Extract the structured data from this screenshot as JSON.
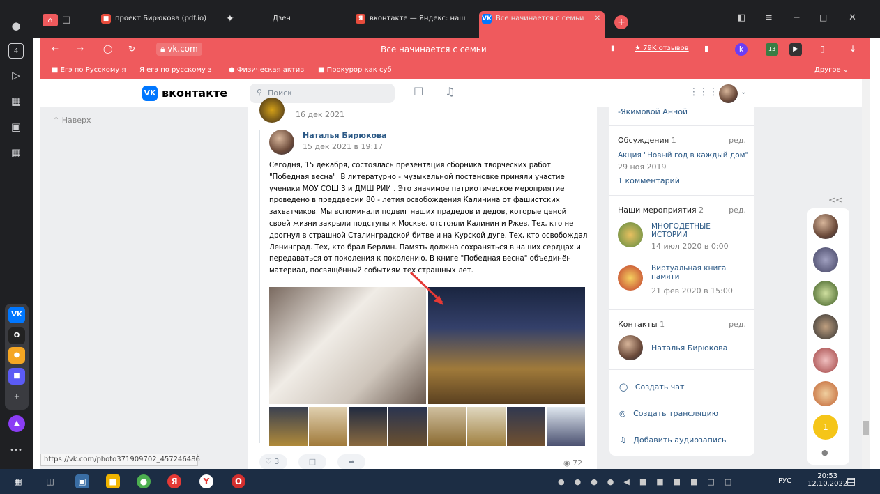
{
  "tabs": [
    {
      "title": "проект Бирюкова (pdf.io)",
      "icon": "pdf-icon"
    },
    {
      "title": "Дзен",
      "icon": "dzen-icon"
    },
    {
      "title": "вконтакте — Яндекс: наш",
      "icon": "yandex-icon"
    },
    {
      "title": "Все начинается с семьи",
      "icon": "vk-icon"
    }
  ],
  "tab_count": "4",
  "address": {
    "domain": "vk.com",
    "page_title": "Все начинается с семьи",
    "reviews": "★ 79K отзывов",
    "badge": "13"
  },
  "bookmarks": [
    "Егэ по Русскому я",
    "егэ по русскому з",
    "Физическая актив",
    "Прокурор как суб"
  ],
  "bookmarks_other": "Другое",
  "vk": {
    "logo": "вконтакте",
    "search_placeholder": "Поиск",
    "back_to_top": "Наверх"
  },
  "post": {
    "parent_date": "16 дек 2021",
    "author": "Наталья Бирюкова",
    "date": "15 дек 2021 в 19:17",
    "text": "Сегодня, 15 декабря, состоялась презентация сборника творческих работ \"Победная весна\". В литературно - музыкальной постановке приняли участие ученики МОУ СОШ 3 и ДМШ РИИ . Это значимое патриотическое мероприятие проведено в преддверии 80 - летия освобождения Калинина от фашистских захватчиков. Мы вспоминали подвиг наших прадедов и дедов, которые ценой своей жизни закрыли подступы к Москве, отстояли Калинин и Ржев. Тех, кто не дрогнул в страшной Сталинградской битве и на Курской дуге. Тех, кто освобождал Ленинград. Тех, кто брал Берлин. Память должна сохраняться в наших сердцах и передаваться от поколения к поколению. В книге \"Победная весна\" объединён материал, посвящённый событиям тех страшных лет.",
    "likes": "3",
    "views": "72"
  },
  "right": {
    "top_text": "-Якимовой Анной",
    "discussions": {
      "title": "Обсуждения",
      "count": "1",
      "edit": "ред.",
      "topic": "Акция \"Новый год в каждый дом\"",
      "date": "29 ноя 2019",
      "comments": "1 комментарий"
    },
    "events": {
      "title": "Наши мероприятия",
      "count": "2",
      "edit": "ред.",
      "items": [
        {
          "name": "МНОГОДЕТНЫЕ ИСТОРИИ",
          "date": "14 июл 2020 в 0:00"
        },
        {
          "name": "Виртуальная книга памяти",
          "date": "21 фев 2020 в 15:00"
        }
      ]
    },
    "contacts": {
      "title": "Контакты",
      "count": "1",
      "edit": "ред.",
      "name": "Наталья Бирюкова"
    },
    "actions": [
      "Создать чат",
      "Создать трансляцию",
      "Добавить аудиозапись"
    ]
  },
  "friends_collapse": "<<",
  "friends_badge": "1",
  "status_url": "https://vk.com/photo371909702_457246486",
  "taskbar": {
    "lang": "РУС",
    "time": "20:53",
    "date": "12.10.2022"
  },
  "colors": {
    "accent": "#ef5a5d",
    "vk_blue": "#0077ff",
    "link": "#2a5885"
  }
}
